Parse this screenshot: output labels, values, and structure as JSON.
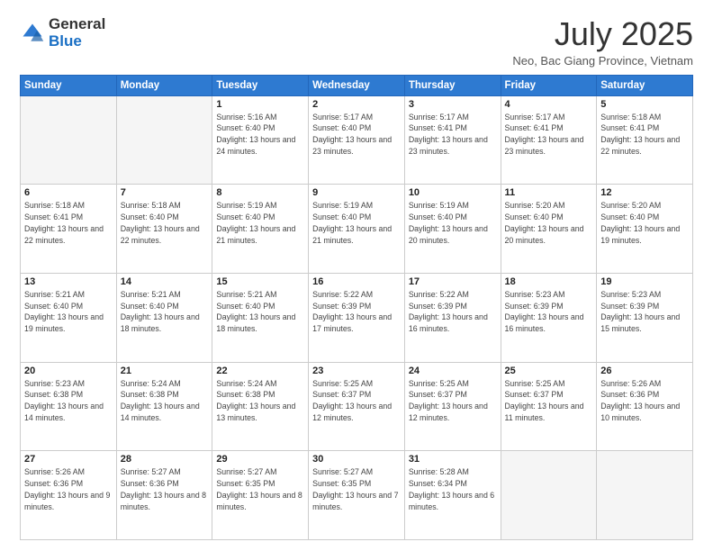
{
  "header": {
    "logo_line1": "General",
    "logo_line2": "Blue",
    "main_title": "July 2025",
    "subtitle": "Neo, Bac Giang Province, Vietnam"
  },
  "calendar": {
    "days_of_week": [
      "Sunday",
      "Monday",
      "Tuesday",
      "Wednesday",
      "Thursday",
      "Friday",
      "Saturday"
    ],
    "weeks": [
      [
        {
          "day": "",
          "info": ""
        },
        {
          "day": "",
          "info": ""
        },
        {
          "day": "1",
          "info": "Sunrise: 5:16 AM\nSunset: 6:40 PM\nDaylight: 13 hours and 24 minutes."
        },
        {
          "day": "2",
          "info": "Sunrise: 5:17 AM\nSunset: 6:40 PM\nDaylight: 13 hours and 23 minutes."
        },
        {
          "day": "3",
          "info": "Sunrise: 5:17 AM\nSunset: 6:41 PM\nDaylight: 13 hours and 23 minutes."
        },
        {
          "day": "4",
          "info": "Sunrise: 5:17 AM\nSunset: 6:41 PM\nDaylight: 13 hours and 23 minutes."
        },
        {
          "day": "5",
          "info": "Sunrise: 5:18 AM\nSunset: 6:41 PM\nDaylight: 13 hours and 22 minutes."
        }
      ],
      [
        {
          "day": "6",
          "info": "Sunrise: 5:18 AM\nSunset: 6:41 PM\nDaylight: 13 hours and 22 minutes."
        },
        {
          "day": "7",
          "info": "Sunrise: 5:18 AM\nSunset: 6:40 PM\nDaylight: 13 hours and 22 minutes."
        },
        {
          "day": "8",
          "info": "Sunrise: 5:19 AM\nSunset: 6:40 PM\nDaylight: 13 hours and 21 minutes."
        },
        {
          "day": "9",
          "info": "Sunrise: 5:19 AM\nSunset: 6:40 PM\nDaylight: 13 hours and 21 minutes."
        },
        {
          "day": "10",
          "info": "Sunrise: 5:19 AM\nSunset: 6:40 PM\nDaylight: 13 hours and 20 minutes."
        },
        {
          "day": "11",
          "info": "Sunrise: 5:20 AM\nSunset: 6:40 PM\nDaylight: 13 hours and 20 minutes."
        },
        {
          "day": "12",
          "info": "Sunrise: 5:20 AM\nSunset: 6:40 PM\nDaylight: 13 hours and 19 minutes."
        }
      ],
      [
        {
          "day": "13",
          "info": "Sunrise: 5:21 AM\nSunset: 6:40 PM\nDaylight: 13 hours and 19 minutes."
        },
        {
          "day": "14",
          "info": "Sunrise: 5:21 AM\nSunset: 6:40 PM\nDaylight: 13 hours and 18 minutes."
        },
        {
          "day": "15",
          "info": "Sunrise: 5:21 AM\nSunset: 6:40 PM\nDaylight: 13 hours and 18 minutes."
        },
        {
          "day": "16",
          "info": "Sunrise: 5:22 AM\nSunset: 6:39 PM\nDaylight: 13 hours and 17 minutes."
        },
        {
          "day": "17",
          "info": "Sunrise: 5:22 AM\nSunset: 6:39 PM\nDaylight: 13 hours and 16 minutes."
        },
        {
          "day": "18",
          "info": "Sunrise: 5:23 AM\nSunset: 6:39 PM\nDaylight: 13 hours and 16 minutes."
        },
        {
          "day": "19",
          "info": "Sunrise: 5:23 AM\nSunset: 6:39 PM\nDaylight: 13 hours and 15 minutes."
        }
      ],
      [
        {
          "day": "20",
          "info": "Sunrise: 5:23 AM\nSunset: 6:38 PM\nDaylight: 13 hours and 14 minutes."
        },
        {
          "day": "21",
          "info": "Sunrise: 5:24 AM\nSunset: 6:38 PM\nDaylight: 13 hours and 14 minutes."
        },
        {
          "day": "22",
          "info": "Sunrise: 5:24 AM\nSunset: 6:38 PM\nDaylight: 13 hours and 13 minutes."
        },
        {
          "day": "23",
          "info": "Sunrise: 5:25 AM\nSunset: 6:37 PM\nDaylight: 13 hours and 12 minutes."
        },
        {
          "day": "24",
          "info": "Sunrise: 5:25 AM\nSunset: 6:37 PM\nDaylight: 13 hours and 12 minutes."
        },
        {
          "day": "25",
          "info": "Sunrise: 5:25 AM\nSunset: 6:37 PM\nDaylight: 13 hours and 11 minutes."
        },
        {
          "day": "26",
          "info": "Sunrise: 5:26 AM\nSunset: 6:36 PM\nDaylight: 13 hours and 10 minutes."
        }
      ],
      [
        {
          "day": "27",
          "info": "Sunrise: 5:26 AM\nSunset: 6:36 PM\nDaylight: 13 hours and 9 minutes."
        },
        {
          "day": "28",
          "info": "Sunrise: 5:27 AM\nSunset: 6:36 PM\nDaylight: 13 hours and 8 minutes."
        },
        {
          "day": "29",
          "info": "Sunrise: 5:27 AM\nSunset: 6:35 PM\nDaylight: 13 hours and 8 minutes."
        },
        {
          "day": "30",
          "info": "Sunrise: 5:27 AM\nSunset: 6:35 PM\nDaylight: 13 hours and 7 minutes."
        },
        {
          "day": "31",
          "info": "Sunrise: 5:28 AM\nSunset: 6:34 PM\nDaylight: 13 hours and 6 minutes."
        },
        {
          "day": "",
          "info": ""
        },
        {
          "day": "",
          "info": ""
        }
      ]
    ]
  }
}
